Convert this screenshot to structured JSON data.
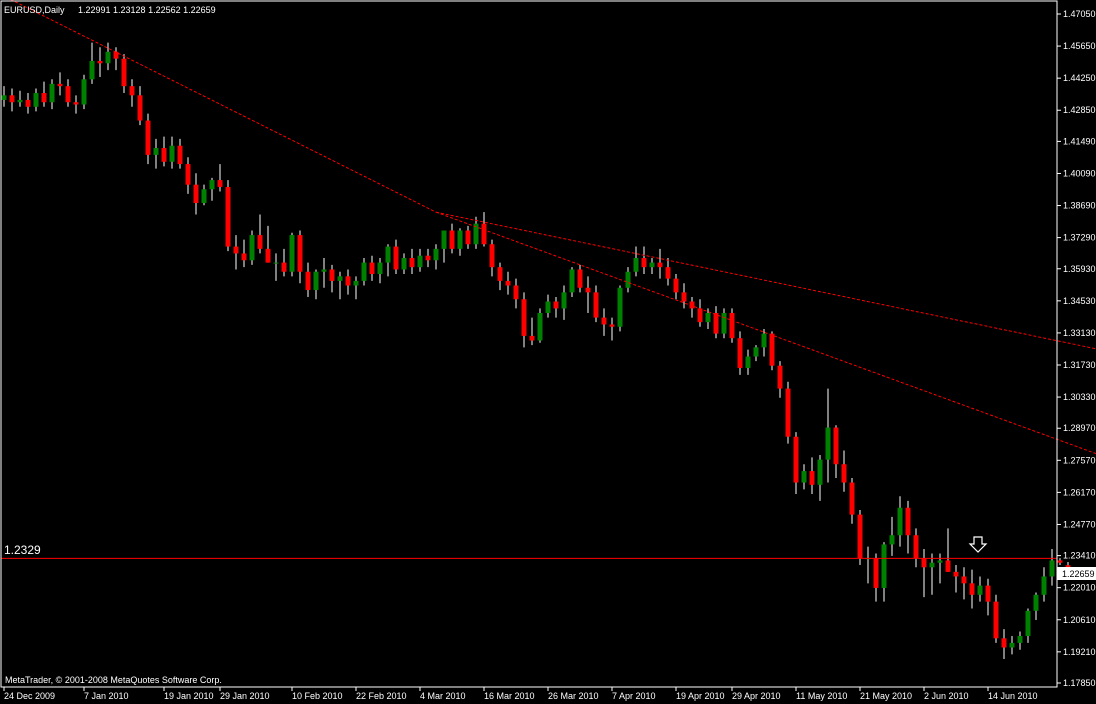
{
  "header": {
    "symbol_label": "EURUSD,Daily",
    "ohlc": "1.22991 1.23128 1.22562 1.22659"
  },
  "footer": {
    "copyright": "MetaTrader, © 2001-2008 MetaQuotes Software Corp."
  },
  "hline": {
    "price": 1.2329,
    "label": "1.2329",
    "color": "#ff0000"
  },
  "current_price": {
    "label": "1.22659",
    "value": 1.22659
  },
  "colors": {
    "background": "#000000",
    "bull": "#008000",
    "bear": "#ff0000",
    "frame": "#ffffff",
    "trendline": "#ff0000"
  },
  "arrow": {
    "icon": "down-arrow-icon"
  },
  "chart_data": {
    "type": "candlestick",
    "y_ticks": [
      "1.47050",
      "1.45650",
      "1.44250",
      "1.42850",
      "1.41490",
      "1.40090",
      "1.38690",
      "1.37290",
      "1.35930",
      "1.34530",
      "1.33130",
      "1.31730",
      "1.30330",
      "1.28970",
      "1.27570",
      "1.26170",
      "1.24770",
      "1.23410",
      "1.22010",
      "1.20610",
      "1.19210",
      "1.17850"
    ],
    "ylim": [
      1.1785,
      1.4705
    ],
    "x_ticks": [
      "24 Dec 2009",
      "7 Jan 2010",
      "19 Jan 2010",
      "29 Jan 2010",
      "10 Feb 2010",
      "22 Feb 2010",
      "4 Mar 2010",
      "16 Mar 2010",
      "26 Mar 2010",
      "7 Apr 2010",
      "19 Apr 2010",
      "29 Apr 2010",
      "11 May 2010",
      "21 May 2010",
      "2 Jun 2010",
      "14 Jun 2010"
    ],
    "tick_index": [
      0,
      10,
      20,
      27,
      36,
      44,
      52,
      60,
      68,
      76,
      84,
      91,
      99,
      107,
      115,
      123
    ],
    "candles": [
      [
        1.433,
        1.439,
        1.43,
        1.435
      ],
      [
        1.435,
        1.438,
        1.428,
        1.432
      ],
      [
        1.432,
        1.437,
        1.43,
        1.433
      ],
      [
        1.433,
        1.436,
        1.427,
        1.43
      ],
      [
        1.43,
        1.438,
        1.428,
        1.436
      ],
      [
        1.436,
        1.441,
        1.43,
        1.432
      ],
      [
        1.432,
        1.442,
        1.429,
        1.44
      ],
      [
        1.44,
        1.445,
        1.435,
        1.439
      ],
      [
        1.439,
        1.442,
        1.43,
        1.432
      ],
      [
        1.432,
        1.435,
        1.427,
        1.431
      ],
      [
        1.431,
        1.444,
        1.429,
        1.442
      ],
      [
        1.442,
        1.458,
        1.44,
        1.45
      ],
      [
        1.45,
        1.456,
        1.443,
        1.449
      ],
      [
        1.449,
        1.458,
        1.446,
        1.454
      ],
      [
        1.454,
        1.456,
        1.446,
        1.451
      ],
      [
        1.451,
        1.453,
        1.436,
        1.439
      ],
      [
        1.439,
        1.442,
        1.43,
        1.435
      ],
      [
        1.435,
        1.439,
        1.422,
        1.424
      ],
      [
        1.424,
        1.427,
        1.405,
        1.409
      ],
      [
        1.409,
        1.416,
        1.403,
        1.412
      ],
      [
        1.412,
        1.417,
        1.404,
        1.406
      ],
      [
        1.406,
        1.417,
        1.403,
        1.413
      ],
      [
        1.413,
        1.416,
        1.403,
        1.405
      ],
      [
        1.405,
        1.408,
        1.392,
        1.396
      ],
      [
        1.396,
        1.401,
        1.383,
        1.388
      ],
      [
        1.388,
        1.396,
        1.387,
        1.394
      ],
      [
        1.394,
        1.399,
        1.389,
        1.398
      ],
      [
        1.398,
        1.405,
        1.393,
        1.395
      ],
      [
        1.395,
        1.398,
        1.367,
        1.369
      ],
      [
        1.369,
        1.374,
        1.359,
        1.366
      ],
      [
        1.366,
        1.372,
        1.36,
        1.363
      ],
      [
        1.363,
        1.376,
        1.361,
        1.374
      ],
      [
        1.374,
        1.383,
        1.366,
        1.368
      ],
      [
        1.368,
        1.378,
        1.362,
        1.362
      ],
      [
        1.362,
        1.366,
        1.354,
        1.362
      ],
      [
        1.362,
        1.368,
        1.356,
        1.358
      ],
      [
        1.358,
        1.375,
        1.356,
        1.374
      ],
      [
        1.374,
        1.376,
        1.353,
        1.358
      ],
      [
        1.358,
        1.362,
        1.347,
        1.35
      ],
      [
        1.35,
        1.359,
        1.346,
        1.358
      ],
      [
        1.358,
        1.364,
        1.351,
        1.359
      ],
      [
        1.359,
        1.361,
        1.349,
        1.354
      ],
      [
        1.354,
        1.358,
        1.346,
        1.356
      ],
      [
        1.356,
        1.359,
        1.348,
        1.352
      ],
      [
        1.352,
        1.356,
        1.346,
        1.354
      ],
      [
        1.354,
        1.364,
        1.352,
        1.362
      ],
      [
        1.362,
        1.365,
        1.354,
        1.357
      ],
      [
        1.357,
        1.364,
        1.353,
        1.362
      ],
      [
        1.362,
        1.37,
        1.356,
        1.369
      ],
      [
        1.369,
        1.372,
        1.357,
        1.359
      ],
      [
        1.359,
        1.366,
        1.357,
        1.364
      ],
      [
        1.364,
        1.368,
        1.357,
        1.36
      ],
      [
        1.36,
        1.368,
        1.358,
        1.365
      ],
      [
        1.365,
        1.368,
        1.36,
        1.363
      ],
      [
        1.363,
        1.37,
        1.359,
        1.368
      ],
      [
        1.368,
        1.376,
        1.362,
        1.376
      ],
      [
        1.376,
        1.379,
        1.366,
        1.368
      ],
      [
        1.368,
        1.377,
        1.365,
        1.376
      ],
      [
        1.376,
        1.378,
        1.368,
        1.37
      ],
      [
        1.37,
        1.382,
        1.368,
        1.379
      ],
      [
        1.379,
        1.384,
        1.369,
        1.37
      ],
      [
        1.37,
        1.372,
        1.356,
        1.36
      ],
      [
        1.36,
        1.362,
        1.35,
        1.354
      ],
      [
        1.354,
        1.358,
        1.348,
        1.352
      ],
      [
        1.352,
        1.355,
        1.342,
        1.346
      ],
      [
        1.346,
        1.349,
        1.325,
        1.33
      ],
      [
        1.33,
        1.338,
        1.326,
        1.328
      ],
      [
        1.328,
        1.342,
        1.327,
        1.34
      ],
      [
        1.34,
        1.348,
        1.338,
        1.345
      ],
      [
        1.345,
        1.347,
        1.338,
        1.342
      ],
      [
        1.342,
        1.352,
        1.337,
        1.349
      ],
      [
        1.349,
        1.36,
        1.347,
        1.359
      ],
      [
        1.359,
        1.361,
        1.349,
        1.351
      ],
      [
        1.351,
        1.356,
        1.34,
        1.349
      ],
      [
        1.349,
        1.352,
        1.336,
        1.338
      ],
      [
        1.338,
        1.342,
        1.33,
        1.335
      ],
      [
        1.335,
        1.338,
        1.328,
        1.334
      ],
      [
        1.334,
        1.352,
        1.332,
        1.351
      ],
      [
        1.351,
        1.36,
        1.349,
        1.358
      ],
      [
        1.358,
        1.369,
        1.356,
        1.364
      ],
      [
        1.364,
        1.369,
        1.357,
        1.36
      ],
      [
        1.36,
        1.364,
        1.357,
        1.362
      ],
      [
        1.362,
        1.368,
        1.355,
        1.36
      ],
      [
        1.36,
        1.364,
        1.352,
        1.355
      ],
      [
        1.355,
        1.357,
        1.346,
        1.349
      ],
      [
        1.349,
        1.353,
        1.342,
        1.345
      ],
      [
        1.345,
        1.347,
        1.338,
        1.342
      ],
      [
        1.342,
        1.346,
        1.334,
        1.336
      ],
      [
        1.336,
        1.342,
        1.333,
        1.34
      ],
      [
        1.34,
        1.343,
        1.329,
        1.331
      ],
      [
        1.331,
        1.342,
        1.329,
        1.34
      ],
      [
        1.34,
        1.342,
        1.327,
        1.329
      ],
      [
        1.329,
        1.332,
        1.313,
        1.316
      ],
      [
        1.316,
        1.324,
        1.313,
        1.321
      ],
      [
        1.321,
        1.326,
        1.319,
        1.325
      ],
      [
        1.325,
        1.333,
        1.321,
        1.331
      ],
      [
        1.331,
        1.332,
        1.315,
        1.317
      ],
      [
        1.317,
        1.319,
        1.303,
        1.307
      ],
      [
        1.307,
        1.31,
        1.283,
        1.286
      ],
      [
        1.286,
        1.288,
        1.261,
        1.266
      ],
      [
        1.266,
        1.274,
        1.263,
        1.271
      ],
      [
        1.271,
        1.277,
        1.261,
        1.265
      ],
      [
        1.265,
        1.278,
        1.258,
        1.276
      ],
      [
        1.276,
        1.307,
        1.266,
        1.29
      ],
      [
        1.29,
        1.291,
        1.268,
        1.274
      ],
      [
        1.274,
        1.28,
        1.262,
        1.266
      ],
      [
        1.266,
        1.268,
        1.248,
        1.252
      ],
      [
        1.252,
        1.254,
        1.23,
        1.233
      ],
      [
        1.233,
        1.238,
        1.222,
        1.233
      ],
      [
        1.233,
        1.235,
        1.214,
        1.22
      ],
      [
        1.22,
        1.24,
        1.214,
        1.239
      ],
      [
        1.239,
        1.251,
        1.234,
        1.243
      ],
      [
        1.243,
        1.26,
        1.238,
        1.255
      ],
      [
        1.255,
        1.258,
        1.235,
        1.243
      ],
      [
        1.243,
        1.246,
        1.229,
        1.233
      ],
      [
        1.233,
        1.237,
        1.216,
        1.229
      ],
      [
        1.229,
        1.235,
        1.217,
        1.231
      ],
      [
        1.231,
        1.235,
        1.222,
        1.232
      ],
      [
        1.232,
        1.246,
        1.227,
        1.227
      ],
      [
        1.227,
        1.23,
        1.218,
        1.225
      ],
      [
        1.225,
        1.229,
        1.215,
        1.222
      ],
      [
        1.222,
        1.228,
        1.211,
        1.217
      ],
      [
        1.217,
        1.225,
        1.214,
        1.221
      ],
      [
        1.221,
        1.224,
        1.208,
        1.214
      ],
      [
        1.214,
        1.217,
        1.196,
        1.198
      ],
      [
        1.198,
        1.202,
        1.189,
        1.194
      ],
      [
        1.194,
        1.199,
        1.191,
        1.196
      ],
      [
        1.196,
        1.201,
        1.193,
        1.199
      ],
      [
        1.199,
        1.211,
        1.196,
        1.21
      ],
      [
        1.21,
        1.218,
        1.206,
        1.217
      ],
      [
        1.217,
        1.229,
        1.214,
        1.225
      ],
      [
        1.225,
        1.237,
        1.221,
        1.232
      ],
      [
        1.232,
        1.233,
        1.23,
        1.231
      ],
      [
        1.2299,
        1.2313,
        1.2256,
        1.2266
      ]
    ],
    "trendlines": [
      {
        "from": [
          -7,
          1.4905
        ],
        "to": [
          54,
          1.384
        ]
      },
      {
        "from": [
          54,
          1.384
        ],
        "to": [
          155,
          1.311
        ]
      },
      {
        "from": [
          54,
          1.384
        ],
        "to": [
          155,
          1.255
        ]
      }
    ]
  }
}
